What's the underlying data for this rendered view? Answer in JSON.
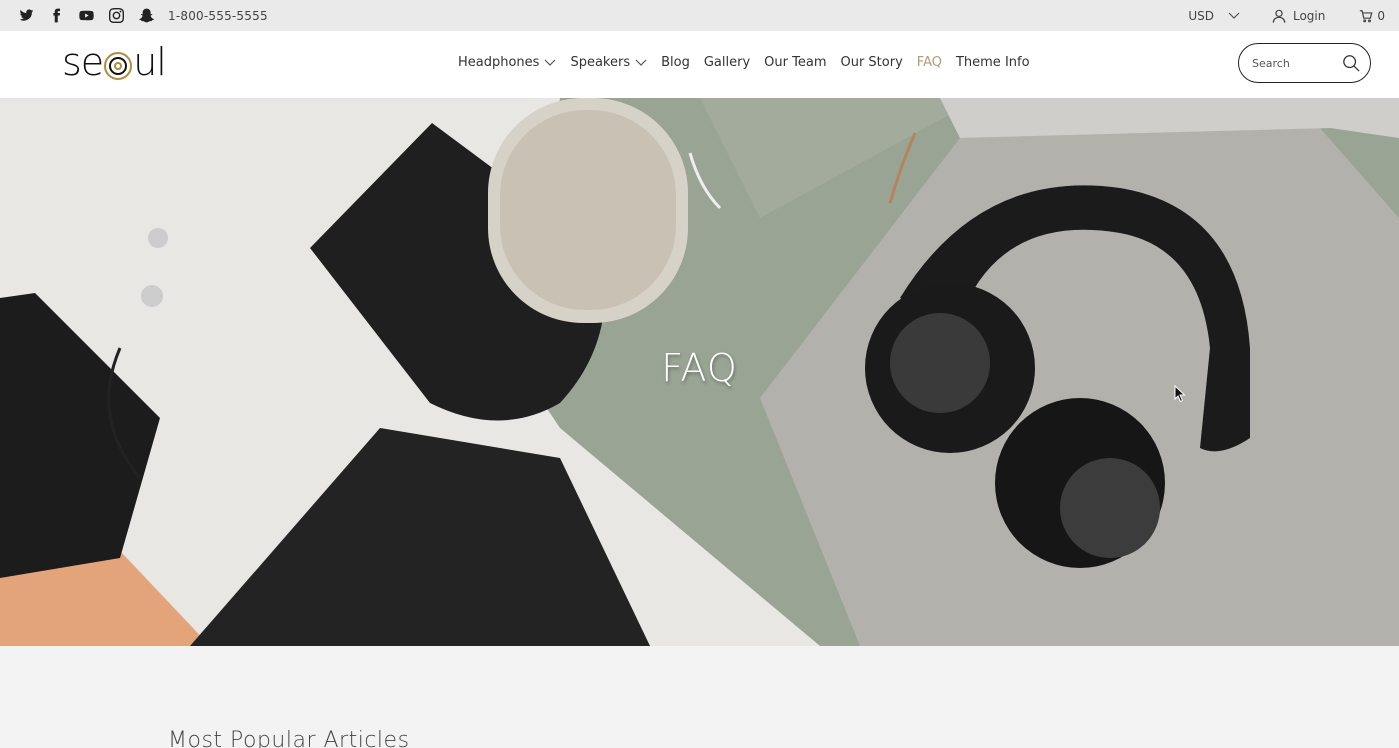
{
  "topbar": {
    "social": [
      "twitter-icon",
      "facebook-icon",
      "youtube-icon",
      "instagram-icon",
      "snapchat-icon"
    ],
    "phone": "1-800-555-5555",
    "currency": "USD",
    "login": "Login",
    "cart_count": "0"
  },
  "header": {
    "logo": {
      "pre": "se",
      "post": "ul"
    },
    "nav": [
      {
        "label": "Headphones",
        "dropdown": true
      },
      {
        "label": "Speakers",
        "dropdown": true
      },
      {
        "label": "Blog"
      },
      {
        "label": "Gallery"
      },
      {
        "label": "Our Team"
      },
      {
        "label": "Our Story"
      },
      {
        "label": "FAQ",
        "active": true
      },
      {
        "label": "Theme Info"
      }
    ],
    "search_placeholder": "Search"
  },
  "hero": {
    "title": "FAQ"
  },
  "content": {
    "heading": "Most Popular Articles"
  },
  "colors": {
    "accent": "#b49a78",
    "topbar_bg": "#eaeaea",
    "page_bg": "#f3f3f3"
  }
}
